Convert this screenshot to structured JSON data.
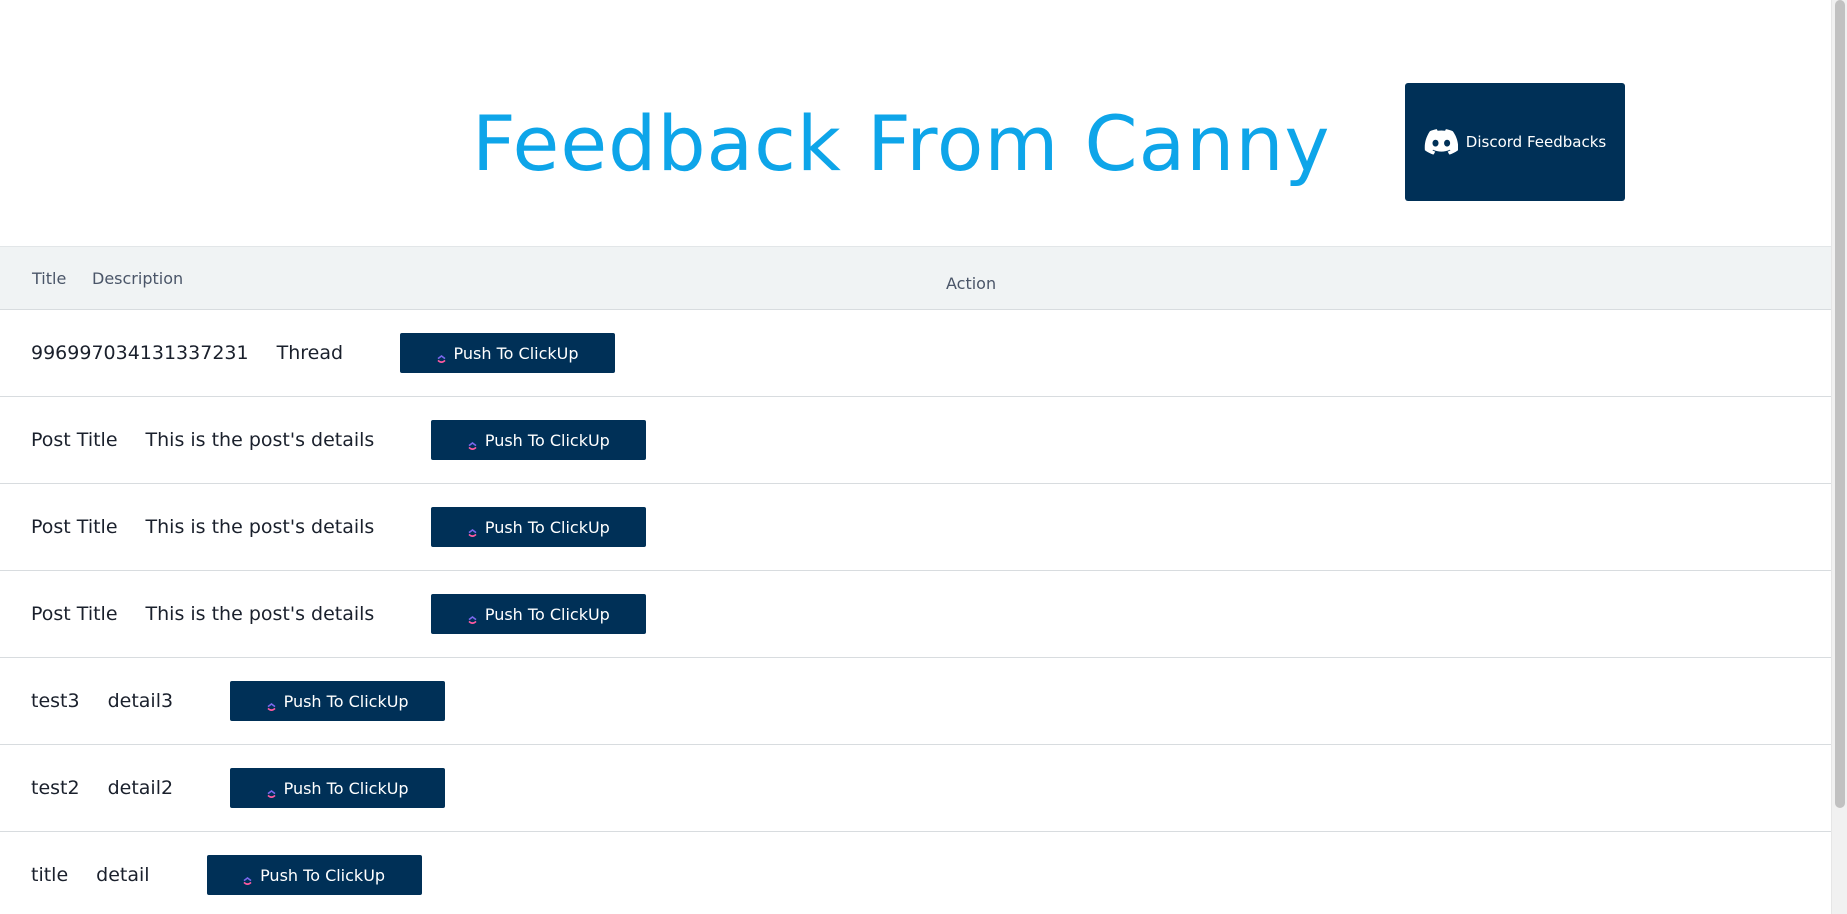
{
  "header": {
    "title": "Feedback From Canny",
    "discord_button_label": "Discord Feedbacks",
    "discord_icon": "discord-icon"
  },
  "table": {
    "columns": {
      "title": "Title",
      "description": "Description",
      "action": "Action"
    },
    "rows": [
      {
        "title": "996997034131337231",
        "description": "Thread",
        "action_label": "Push To ClickUp"
      },
      {
        "title": "Post Title",
        "description": "This is the post's details",
        "action_label": "Push To ClickUp"
      },
      {
        "title": "Post Title",
        "description": "This is the post's details",
        "action_label": "Push To ClickUp"
      },
      {
        "title": "Post Title",
        "description": "This is the post's details",
        "action_label": "Push To ClickUp"
      },
      {
        "title": "test3",
        "description": "detail3",
        "action_label": "Push To ClickUp"
      },
      {
        "title": "test2",
        "description": "detail2",
        "action_label": "Push To ClickUp"
      },
      {
        "title": "title",
        "description": "detail",
        "action_label": "Push To ClickUp"
      }
    ],
    "action_icon": "clickup-icon"
  },
  "colors": {
    "title": "#0ea5e9",
    "button_bg": "#003057",
    "button_text": "#ffffff",
    "table_header_bg": "#f0f3f4",
    "divider": "#d8dcdf"
  }
}
